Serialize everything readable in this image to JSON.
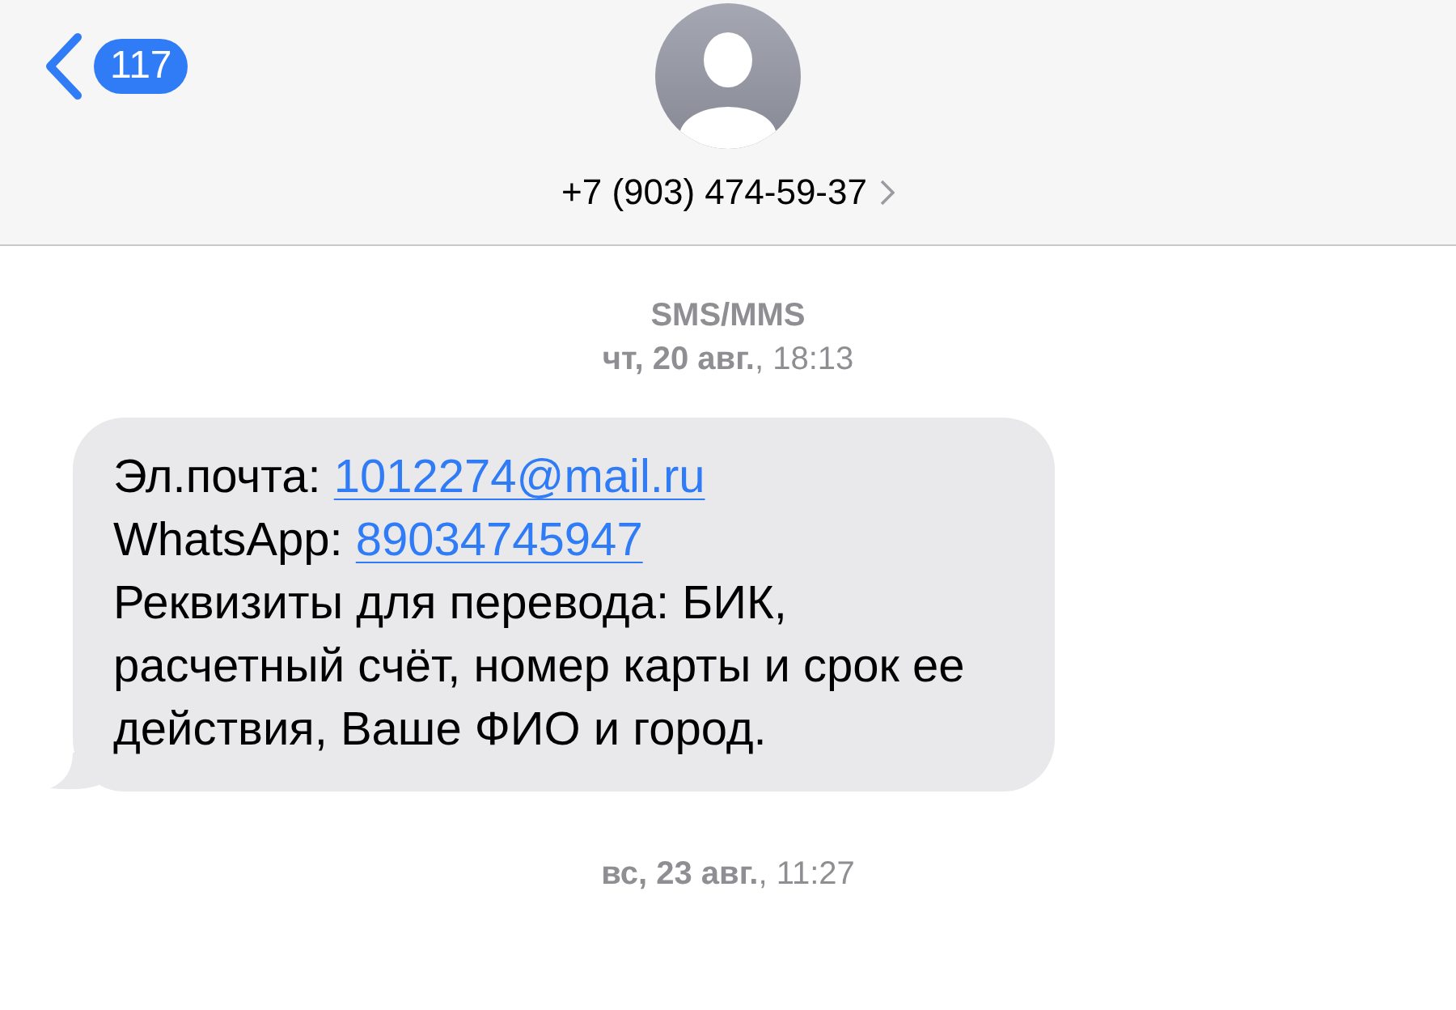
{
  "header": {
    "back_badge": "117",
    "contact": "+7 (903) 474-59-37"
  },
  "service_label": "SMS/MMS",
  "timestamps": [
    "**чт, 20 авг.**, 18:13",
    "**вс, 23 авг.**, 11:27"
  ],
  "message": {
    "lines": [
      {
        "kind": "field",
        "label": "Эл.почта:",
        "link": "1012274@mail.ru"
      },
      {
        "kind": "field",
        "label": "WhatsApp:",
        "link": "89034745947"
      },
      {
        "kind": "text",
        "text": "Реквизиты для перевода: БИК, расчетный счёт, номер карты и срок ее действия, Ваше ФИО и город."
      }
    ]
  }
}
